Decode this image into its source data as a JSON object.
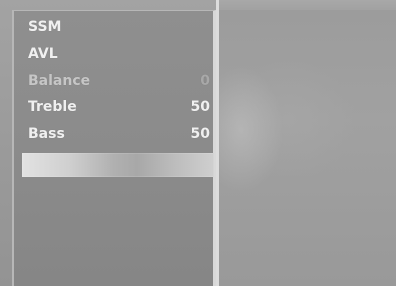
{
  "menu": {
    "items": [
      {
        "label": "SSM",
        "value": ""
      },
      {
        "label": "AVL",
        "value": ""
      },
      {
        "label": "Balance",
        "value": "0"
      },
      {
        "label": "Treble",
        "value": "50"
      },
      {
        "label": "Bass",
        "value": "50"
      }
    ]
  },
  "colors": {
    "background": "#9a9a9a",
    "menu_panel": "#8b8b8b",
    "text": "#f0f0f0",
    "dim_text": "#c6c6c6",
    "highlight": "#d0d0d0"
  }
}
